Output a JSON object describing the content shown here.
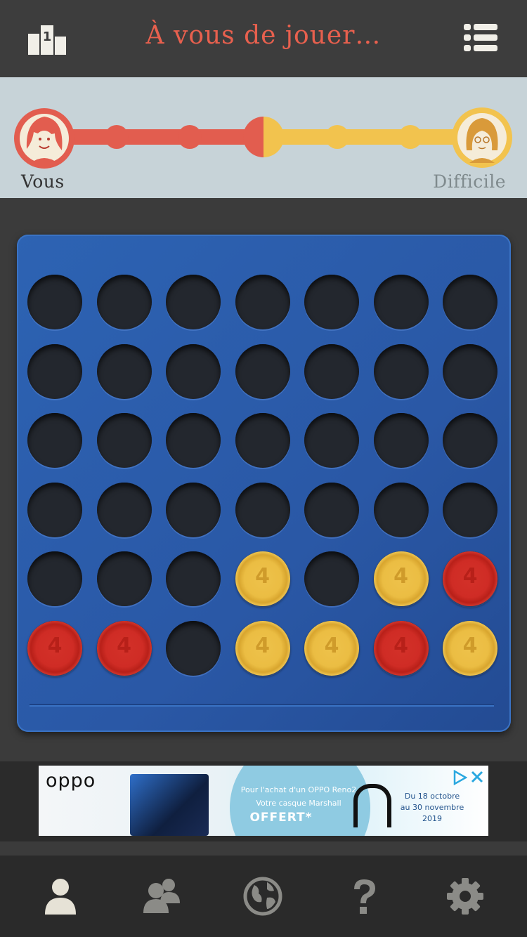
{
  "header": {
    "title": "À vous de jouer…",
    "podium_number": "1"
  },
  "progress": {
    "player_label": "Vous",
    "opponent_label": "Difficile",
    "player_color": "#e25d4f",
    "opponent_color": "#f2c34e"
  },
  "board": {
    "columns": 7,
    "rows": 6,
    "cells": [
      [
        "empty",
        "empty",
        "empty",
        "empty",
        "empty",
        "empty",
        "empty"
      ],
      [
        "empty",
        "empty",
        "empty",
        "empty",
        "empty",
        "empty",
        "empty"
      ],
      [
        "empty",
        "empty",
        "empty",
        "empty",
        "empty",
        "empty",
        "empty"
      ],
      [
        "empty",
        "empty",
        "empty",
        "empty",
        "empty",
        "empty",
        "empty"
      ],
      [
        "empty",
        "empty",
        "empty",
        "yellow",
        "empty",
        "yellow",
        "red"
      ],
      [
        "red",
        "red",
        "empty",
        "yellow",
        "yellow",
        "red",
        "yellow"
      ]
    ],
    "token_mark": "4"
  },
  "ad": {
    "brand": "oppo",
    "line1": "Pour l'achat d'un OPPO Reno2",
    "line2": "Votre casque Marshall",
    "offer": "OFFERT*",
    "date_line1": "Du 18 octobre",
    "date_line2": "au 30 novembre 2019"
  },
  "nav": {
    "items": [
      "person-icon",
      "people-icon",
      "globe-icon",
      "help-icon",
      "settings-icon"
    ],
    "active": "person-icon"
  }
}
